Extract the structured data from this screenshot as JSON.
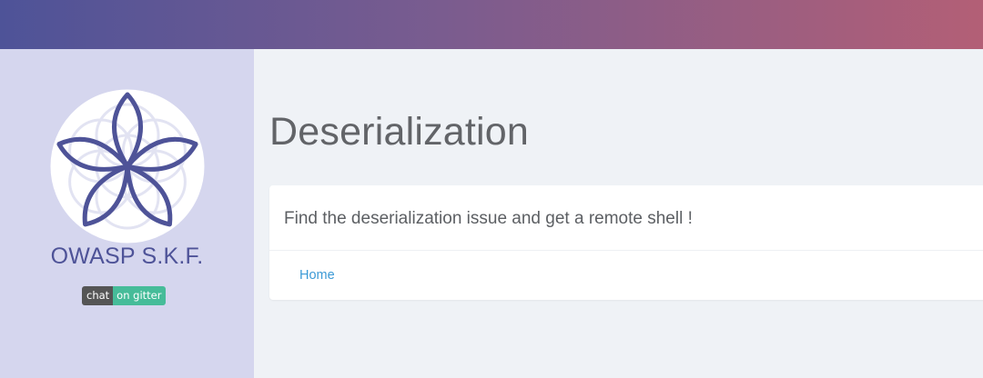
{
  "header": {
    "gradient_start": "#4e5398",
    "gradient_end": "#b35f76"
  },
  "sidebar": {
    "logo_icon": "owasp-skf-flower-icon",
    "brand": "OWASP S.K.F.",
    "badge": {
      "left_label": "chat",
      "right_label": "on gitter",
      "right_color": "#46bc99"
    }
  },
  "main": {
    "title": "Deserialization",
    "card": {
      "description": "Find the deserialization issue and get a remote shell !",
      "link_label": "Home",
      "link_color": "#3c9ad6"
    }
  }
}
